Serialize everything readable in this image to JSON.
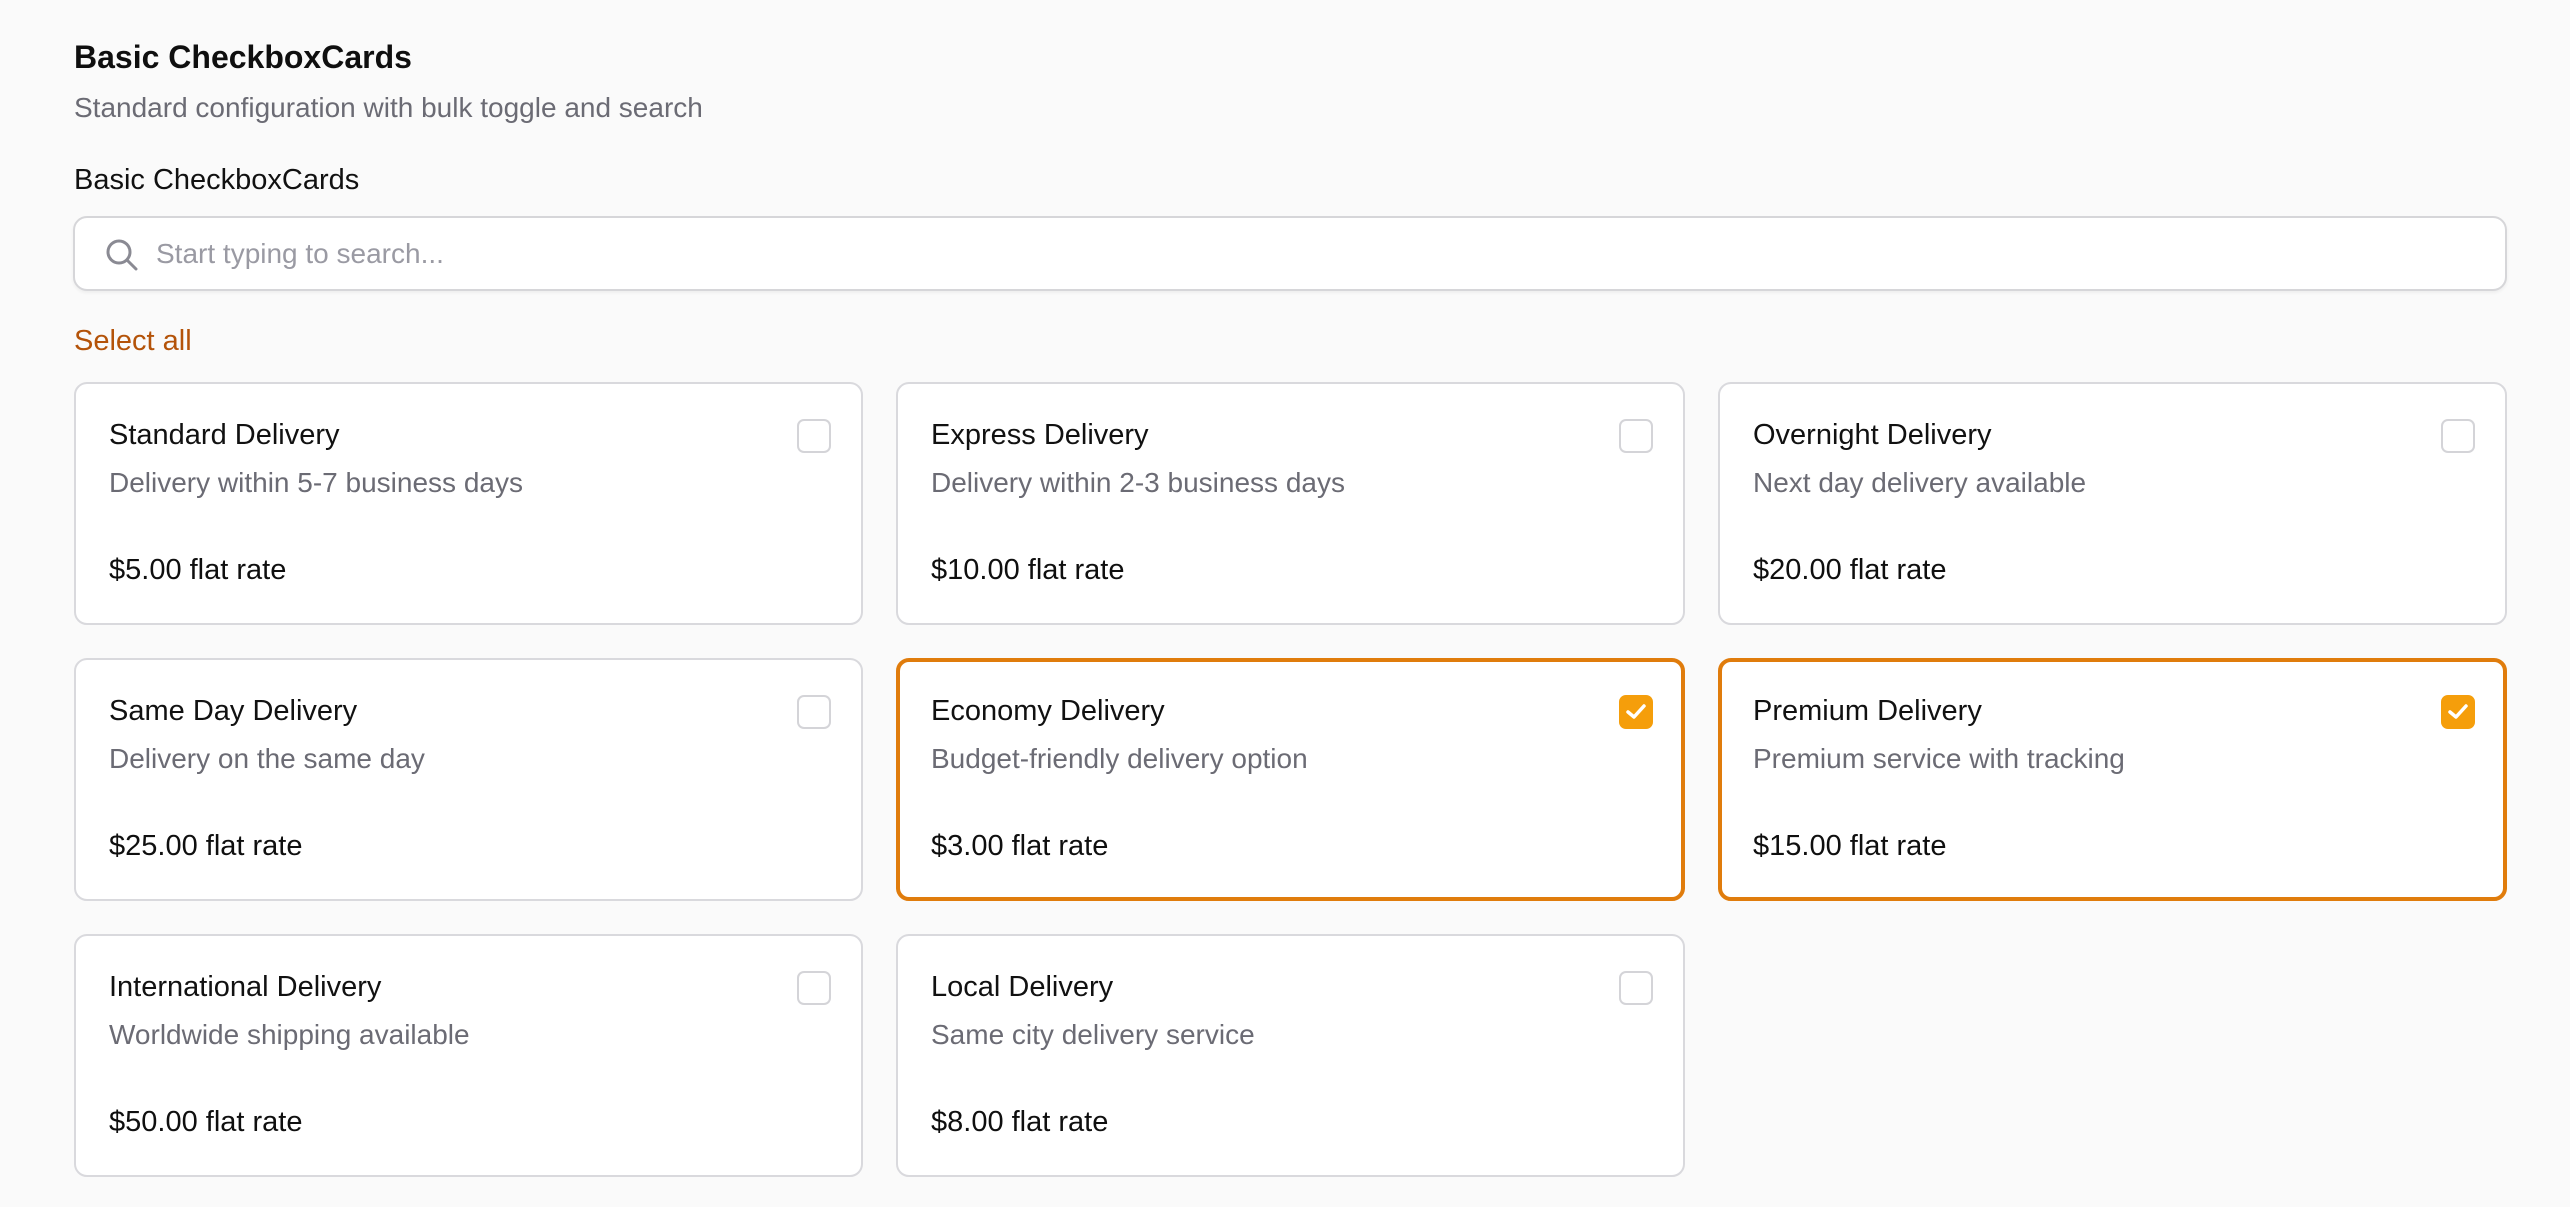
{
  "header": {
    "title": "Basic CheckboxCards",
    "subtitle": "Standard configuration with bulk toggle and search"
  },
  "field": {
    "label": "Basic CheckboxCards"
  },
  "search": {
    "placeholder": "Start typing to search...",
    "value": "",
    "icon": "search-icon"
  },
  "bulk": {
    "select_all_label": "Select all"
  },
  "colors": {
    "accent": "#f59e0b",
    "accent_border": "#e07c0c",
    "link": "#b45309",
    "muted_text": "#6b6b74"
  },
  "cards": [
    {
      "title": "Standard Delivery",
      "description": "Delivery within 5-7 business days",
      "price": "$5.00 flat rate",
      "checked": false
    },
    {
      "title": "Express Delivery",
      "description": "Delivery within 2-3 business days",
      "price": "$10.00 flat rate",
      "checked": false
    },
    {
      "title": "Overnight Delivery",
      "description": "Next day delivery available",
      "price": "$20.00 flat rate",
      "checked": false
    },
    {
      "title": "Same Day Delivery",
      "description": "Delivery on the same day",
      "price": "$25.00 flat rate",
      "checked": false
    },
    {
      "title": "Economy Delivery",
      "description": "Budget-friendly delivery option",
      "price": "$3.00 flat rate",
      "checked": true
    },
    {
      "title": "Premium Delivery",
      "description": "Premium service with tracking",
      "price": "$15.00 flat rate",
      "checked": true
    },
    {
      "title": "International Delivery",
      "description": "Worldwide shipping available",
      "price": "$50.00 flat rate",
      "checked": false
    },
    {
      "title": "Local Delivery",
      "description": "Same city delivery service",
      "price": "$8.00 flat rate",
      "checked": false
    }
  ]
}
